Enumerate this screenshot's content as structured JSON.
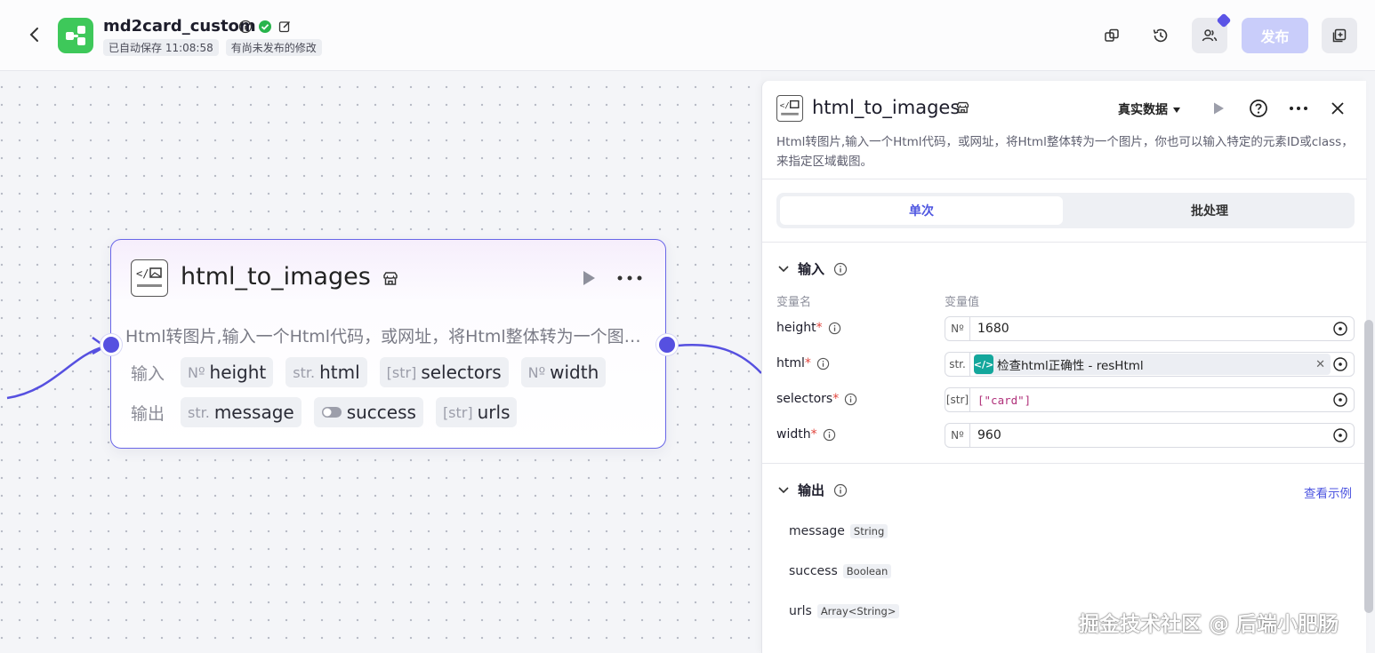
{
  "header": {
    "app_title": "md2card_custom",
    "autosave_badge": "已自动保存 11:08:58",
    "unpublished_badge": "有尚未发布的修改",
    "publish_label": "发布"
  },
  "node": {
    "title": "html_to_images",
    "description": "Html转图片,输入一个Html代码，或网址，将Html整体转为一个图片，你也可以输入特定的元素ID或class，来指定区域截图。",
    "input_label": "输入",
    "output_label": "输出",
    "inputs": [
      {
        "type": "Nº",
        "name": "height"
      },
      {
        "type": "str.",
        "name": "html"
      },
      {
        "type": "[str]",
        "name": "selectors"
      },
      {
        "type": "Nº",
        "name": "width"
      }
    ],
    "outputs": [
      {
        "type": "str.",
        "name": "message"
      },
      {
        "type": "toggle",
        "name": "success"
      },
      {
        "type": "[str]",
        "name": "urls"
      }
    ]
  },
  "panel": {
    "title": "html_to_images",
    "data_mode": "真实数据",
    "description": "Html转图片,输入一个Html代码，或网址，将Html整体转为一个图片，你也可以输入特定的元素ID或class，来指定区域截图。",
    "tabs": [
      "单次",
      "批处理"
    ],
    "input_section": "输入",
    "col_name": "变量名",
    "col_value": "变量值",
    "fields": [
      {
        "name": "height",
        "type": "Nº",
        "value": "1680"
      },
      {
        "name": "html",
        "type": "str.",
        "ref_label": "检查html正确性 - resHtml"
      },
      {
        "name": "selectors",
        "type": "[str]",
        "value": "[\"card\"]"
      },
      {
        "name": "width",
        "type": "Nº",
        "value": "960"
      }
    ],
    "output_section": "输出",
    "view_example": "查看示例",
    "outputs": [
      {
        "name": "message",
        "type": "String"
      },
      {
        "name": "success",
        "type": "Boolean"
      },
      {
        "name": "urls",
        "type": "Array<String>"
      }
    ]
  },
  "watermark": "掘金技术社区 @ 后端小肥肠",
  "colors": {
    "accent": "#4d55e0",
    "node_border": "#6966e8",
    "port": "#5650e0",
    "logo": "#3ec85a"
  }
}
